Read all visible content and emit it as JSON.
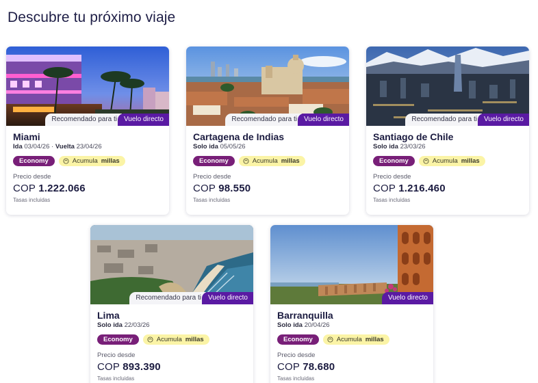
{
  "page": {
    "title": "Descubre tu próximo viaje"
  },
  "tags": {
    "recommended": "Recomendado para ti",
    "direct": "Vuelo directo"
  },
  "labels": {
    "economy": "Economy",
    "accumulate_prefix": "Acumula",
    "accumulate_bold": "millas",
    "price_from": "Precio desde",
    "taxes": "Tasas incluidas",
    "currency": "COP"
  },
  "cards": [
    {
      "city": "Miami",
      "trip_type": "Ida",
      "date_out": "03/04/26",
      "return_label": "Vuelta",
      "date_return": "23/04/26",
      "price": "1.222.066",
      "show_recommended": true
    },
    {
      "city": "Cartagena de Indias",
      "trip_type": "Solo ida",
      "date_out": "05/05/26",
      "price": "98.550",
      "show_recommended": true
    },
    {
      "city": "Santiago de Chile",
      "trip_type": "Solo ida",
      "date_out": "23/03/26",
      "price": "1.216.460",
      "show_recommended": true
    },
    {
      "city": "Lima",
      "trip_type": "Solo ida",
      "date_out": "22/03/26",
      "price": "893.390",
      "show_recommended": true
    },
    {
      "city": "Barranquilla",
      "trip_type": "Solo ida",
      "date_out": "20/04/26",
      "price": "78.680",
      "show_recommended": false
    }
  ],
  "colors": {
    "economy": "#781f78",
    "direct": "#5a1aa3",
    "millas": "#fbf4a6"
  }
}
